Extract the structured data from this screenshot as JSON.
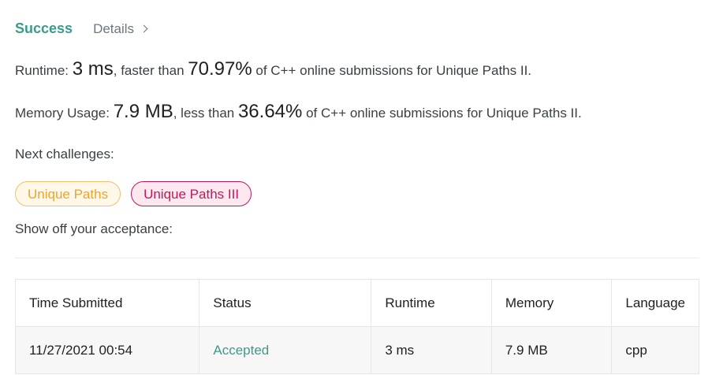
{
  "header": {
    "status": "Success",
    "details_label": "Details"
  },
  "runtime_line": {
    "prefix": "Runtime: ",
    "value": "3 ms",
    "middle": ", faster than ",
    "percent": "70.97%",
    "suffix": " of C++ online submissions for Unique Paths II."
  },
  "memory_line": {
    "prefix": "Memory Usage: ",
    "value": "7.9 MB",
    "middle": ", less than ",
    "percent": "36.64%",
    "suffix": " of C++ online submissions for Unique Paths II."
  },
  "next_challenges": {
    "label": "Next challenges:",
    "items": [
      {
        "label": "Unique Paths",
        "difficulty_color": "#f0a52a"
      },
      {
        "label": "Unique Paths III",
        "difficulty_color": "#c2185b"
      }
    ]
  },
  "show_off_label": "Show off your acceptance:",
  "table": {
    "headers": [
      "Time Submitted",
      "Status",
      "Runtime",
      "Memory",
      "Language"
    ],
    "rows": [
      {
        "time": "11/27/2021 00:54",
        "status": "Accepted",
        "runtime": "3 ms",
        "memory": "7.9 MB",
        "language": "cpp"
      }
    ]
  },
  "colors": {
    "accent": "#3b9b8b",
    "easy": "#f0a52a",
    "hard": "#c2185b"
  }
}
